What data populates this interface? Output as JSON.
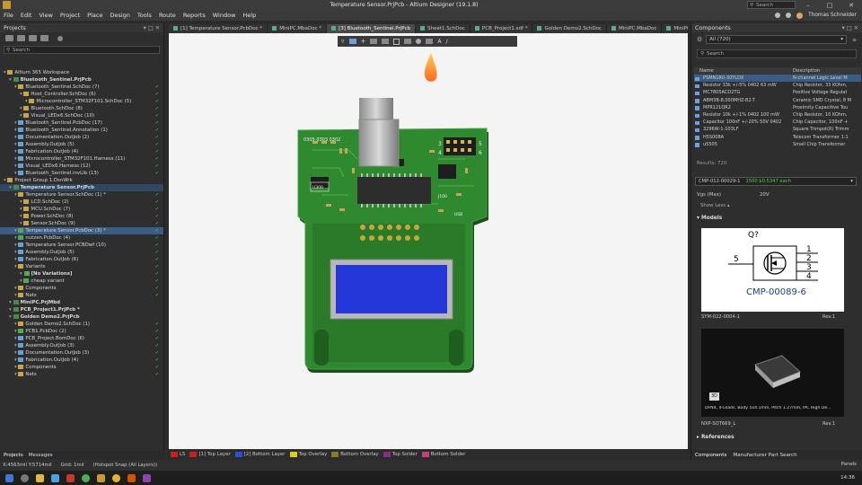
{
  "window": {
    "title": "Temperature Sensor.PrjPcb - Altium Designer (19.1.8)"
  },
  "menu": [
    "File",
    "Edit",
    "View",
    "Project",
    "Place",
    "Design",
    "Tools",
    "Route",
    "Reports",
    "Window",
    "Help"
  ],
  "header": {
    "search_placeholder": "Search",
    "user": "Thomas Schneider"
  },
  "projects_panel": {
    "title": "Projects",
    "search_placeholder": "Search",
    "tree": [
      {
        "label": "Altium 365 Workspace",
        "indent": 0,
        "icon": "folder",
        "style": ""
      },
      {
        "label": "Bluetooth_Sentinel.PrjPcb",
        "indent": 1,
        "icon": "proj",
        "style": "bold"
      },
      {
        "label": "Bluetooth_Sentinel.SchDoc (7)",
        "indent": 2,
        "icon": "folder",
        "style": ""
      },
      {
        "label": "Host_Controller.SchDoc (6)",
        "indent": 3,
        "icon": "folder",
        "style": ""
      },
      {
        "label": "Microcontroller_STM32F101.SchDoc (5)",
        "indent": 4,
        "icon": "folder",
        "style": ""
      },
      {
        "label": "Bluetooth.SchDoc (8)",
        "indent": 3,
        "icon": "folder",
        "style": ""
      },
      {
        "label": "Visual_LEDx6.SchDoc (10)",
        "indent": 3,
        "icon": "folder",
        "style": ""
      },
      {
        "label": "Bluetooth_Sentinel.PcbDoc (17)",
        "indent": 2,
        "icon": "doc",
        "style": ""
      },
      {
        "label": "Bluetooth_Sentinel.Annotation (1)",
        "indent": 2,
        "icon": "doc",
        "style": ""
      },
      {
        "label": "Documentation.OutJob (2)",
        "indent": 2,
        "icon": "doc",
        "style": ""
      },
      {
        "label": "Assembly.OutJob (5)",
        "indent": 2,
        "icon": "doc",
        "style": ""
      },
      {
        "label": "Fabrication.OutJob (4)",
        "indent": 2,
        "icon": "doc",
        "style": ""
      },
      {
        "label": "Microcontroller_STM32F101.Harness (11)",
        "indent": 2,
        "icon": "doc",
        "style": ""
      },
      {
        "label": "Visual_LEDx6.Harness (12)",
        "indent": 2,
        "icon": "doc",
        "style": ""
      },
      {
        "label": "Bluetooth_Sentinel.invLib (13)",
        "indent": 2,
        "icon": "doc",
        "style": ""
      },
      {
        "label": "Project Group 1.DsnWrk",
        "indent": 0,
        "icon": "folder",
        "style": ""
      },
      {
        "label": "Temperature Sensor.PrjPcb",
        "indent": 1,
        "icon": "proj",
        "style": "bold hl"
      },
      {
        "label": "Temperature Sensor.SchDoc (1) *",
        "indent": 2,
        "icon": "folder",
        "style": ""
      },
      {
        "label": "LCD.SchDoc (2)",
        "indent": 3,
        "icon": "folder",
        "style": ""
      },
      {
        "label": "MCU.SchDoc (7)",
        "indent": 3,
        "icon": "folder",
        "style": ""
      },
      {
        "label": "Power.SchDoc (8)",
        "indent": 3,
        "icon": "folder",
        "style": ""
      },
      {
        "label": "Sensor.SchDoc (9)",
        "indent": 3,
        "icon": "folder",
        "style": ""
      },
      {
        "label": "Temperature Sensor.PcbDoc (3) *",
        "indent": 2,
        "icon": "grn",
        "style": "sel"
      },
      {
        "label": "nutzen.PcbDoc (4)",
        "indent": 2,
        "icon": "grn",
        "style": ""
      },
      {
        "label": "Temperature Sensor.PCBDwf (10)",
        "indent": 2,
        "icon": "doc",
        "style": ""
      },
      {
        "label": "Assembly.OutJob (5)",
        "indent": 2,
        "icon": "doc",
        "style": ""
      },
      {
        "label": "Fabrication.OutJob (6)",
        "indent": 2,
        "icon": "doc",
        "style": ""
      },
      {
        "label": "Variants",
        "indent": 2,
        "icon": "folder",
        "style": ""
      },
      {
        "label": "[No Variations]",
        "indent": 3,
        "icon": "grn",
        "style": "bold"
      },
      {
        "label": "cheap variant",
        "indent": 3,
        "icon": "grn",
        "style": ""
      },
      {
        "label": "Components",
        "indent": 2,
        "icon": "folder",
        "style": ""
      },
      {
        "label": "Nets",
        "indent": 2,
        "icon": "folder",
        "style": ""
      },
      {
        "label": "MiniPC.PrjMbd",
        "indent": 1,
        "icon": "proj",
        "style": "bold"
      },
      {
        "label": "PCB_Project1.PrjPcb *",
        "indent": 1,
        "icon": "proj",
        "style": "bold"
      },
      {
        "label": "Golden Demo2.PrjPcb",
        "indent": 1,
        "icon": "proj",
        "style": "bold"
      },
      {
        "label": "Golden Demo2.SchDoc (1)",
        "indent": 2,
        "icon": "folder",
        "style": ""
      },
      {
        "label": "PCB1.PcbDoc (2)",
        "indent": 2,
        "icon": "grn",
        "style": ""
      },
      {
        "label": "PCB_Project.BomDoc (6)",
        "indent": 2,
        "icon": "doc",
        "style": ""
      },
      {
        "label": "Assembly.OutJob (3)",
        "indent": 2,
        "icon": "doc",
        "style": ""
      },
      {
        "label": "Documentation.OutJob (3)",
        "indent": 2,
        "icon": "doc",
        "style": ""
      },
      {
        "label": "Fabrication.OutJob (4)",
        "indent": 2,
        "icon": "doc",
        "style": ""
      },
      {
        "label": "Components",
        "indent": 2,
        "icon": "folder",
        "style": ""
      },
      {
        "label": "Nets",
        "indent": 2,
        "icon": "folder",
        "style": ""
      }
    ],
    "tabs": [
      "Projects",
      "Messages"
    ]
  },
  "doc_tabs": [
    {
      "label": "[1] Temperature Sensor.PcbDoc *",
      "active": false
    },
    {
      "label": "MiniPC.MbaDoc *",
      "active": false
    },
    {
      "label": "[3] Bluetooth_Sentinel.PrjPcb",
      "active": true
    },
    {
      "label": "Sheet1.SchDoc",
      "active": false
    },
    {
      "label": "PCB_Project1.sdf *",
      "active": false
    },
    {
      "label": "Golden Demo2.SchDoc",
      "active": false
    },
    {
      "label": "MiniPC.MbaDoc",
      "active": false
    },
    {
      "label": "MiniPC_Func.SchDoc",
      "active": false
    }
  ],
  "pcb": {
    "board_color": "#2f8a2f",
    "silk_labels": [
      "0305 0303 0302",
      "U300",
      "3",
      "5",
      "4",
      "6",
      "J100",
      "USB"
    ]
  },
  "layers": [
    {
      "label": "LS",
      "color": "#d01e1e"
    },
    {
      "label": "[1] Top Layer",
      "color": "#d01e1e"
    },
    {
      "label": "[2] Bottom Layer",
      "color": "#2a4ddb"
    },
    {
      "label": "Top Overlay",
      "color": "#e0d000"
    },
    {
      "label": "Bottom Overlay",
      "color": "#8a7a2a"
    },
    {
      "label": "Top Solder",
      "color": "#8a2a8a"
    },
    {
      "label": "Bottom Solder",
      "color": "#c04080"
    }
  ],
  "components_panel": {
    "title": "Components",
    "filter": "All  (720)",
    "search_placeholder": "Search",
    "columns": [
      "Name",
      "Description"
    ],
    "rows": [
      {
        "name": "PSMN1R0-30YLDX",
        "desc": "N-channel Logic Level M",
        "sel": true
      },
      {
        "name": "Resistor 33k +/-5% 0402 63 mW",
        "desc": "Chip Resistor, 33 KOhm,",
        "sel": false
      },
      {
        "name": "MC7805ACD2TG",
        "desc": "Positive Voltage Regulat",
        "sel": false
      },
      {
        "name": "ABM3B-8.000MHZ-B2-T",
        "desc": "Ceramic SMD Crystal, 8 M",
        "sel": false
      },
      {
        "name": "MPR121QR2",
        "desc": "Proximity Capacitive Tou",
        "sel": false
      },
      {
        "name": "Resistor 10k +/-1% 0402 100 mW",
        "desc": "Chip Resistor, 10 KOhm,",
        "sel": false
      },
      {
        "name": "Capacitor 100nF +/-20% 50V 0402",
        "desc": "Chip Capacitor, 100nF +",
        "sel": false
      },
      {
        "name": "3296W-1-103LF",
        "desc": "Square Trimpot(R) Trimm",
        "sel": false
      },
      {
        "name": "H5S008A",
        "desc": "Telecom Transformer 1:1",
        "sel": false
      },
      {
        "name": "u5505",
        "desc": "Small Chip Transformer",
        "sel": false
      }
    ],
    "results": "Results: 720",
    "part_id": "CMP-012-00029-1",
    "stock": "1500  $0.5347 each",
    "param_name": "Vgs (Max)",
    "param_value": "20V",
    "show_less": "Show Less",
    "models_heading": "Models",
    "symbol_label": "CMP-00089-6",
    "symbol_refdes": "Q?",
    "symbol_pins": [
      "1",
      "2",
      "3",
      "4",
      "5"
    ],
    "symbol_name": "SYM-022-0004-1",
    "symbol_rev": "Rev.1",
    "footprint_desc": "DFN4, 4-Leads, Body 5x4.1mm, Pitch 1.27mm, IPC High De...",
    "footprint_name": "NXP-SOT669_L",
    "footprint_rev": "Rev.1",
    "badge": "3D",
    "references": "References",
    "tabs": [
      "Components",
      "Manufacturer Part Search"
    ]
  },
  "status": {
    "coords": "X:4563mil Y:5714mil",
    "grid": "Grid: 1mil",
    "snap": "(Hotspot Snap (All Layers))",
    "panels": "Panels"
  },
  "clock": "14:36"
}
